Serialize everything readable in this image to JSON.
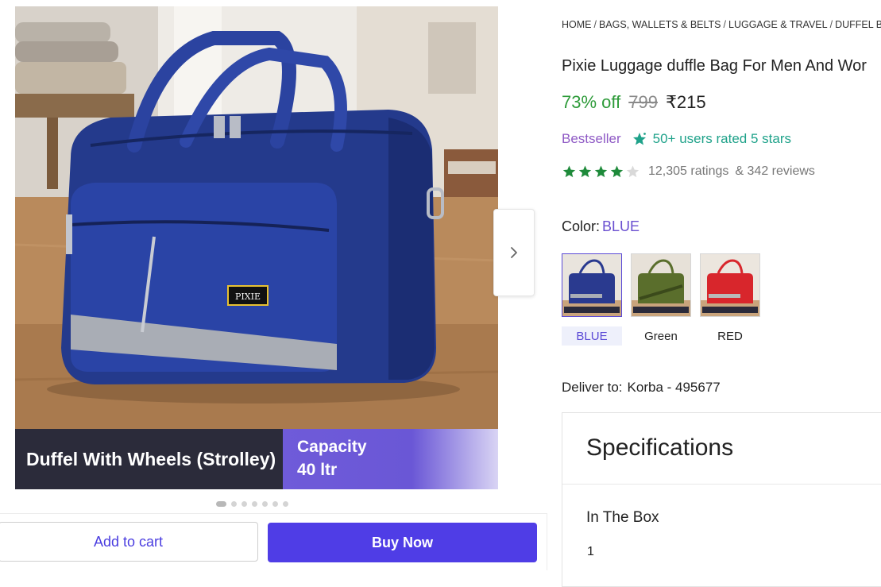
{
  "breadcrumb": [
    "HOME",
    "BAGS, WALLETS & BELTS",
    "LUGGAGE & TRAVEL",
    "DUFFEL B"
  ],
  "product": {
    "title": "Pixie Luggage duffle Bag For Men And Wor",
    "discount": "73% off",
    "mrp": "799",
    "price": "₹215",
    "badge": "Bestseller",
    "rated_text": "50+ users rated 5 stars",
    "rating_value": 4,
    "ratings_count": "12,305 ratings",
    "reviews_count": "& 342 reviews"
  },
  "gallery": {
    "brand_label": "PIXIE",
    "banner_left": "Duffel With Wheels (Strolley)",
    "banner_right_line1": "Capacity",
    "banner_right_line2": "40 ltr",
    "next_icon": "chevron-right-icon",
    "dots_count": 7,
    "active_dot": 0
  },
  "color": {
    "label": "Color:",
    "selected": "BLUE",
    "options": [
      {
        "name": "BLUE",
        "hex": "#2a3a8f"
      },
      {
        "name": "Green",
        "hex": "#5a6e2c"
      },
      {
        "name": "RED",
        "hex": "#d8262c"
      }
    ]
  },
  "delivery": {
    "label": "Deliver to:",
    "location": "Korba - 495677"
  },
  "specifications": {
    "title": "Specifications",
    "rows": [
      {
        "key": "In The Box",
        "value": "1"
      }
    ]
  },
  "actions": {
    "add_to_cart": "Add to cart",
    "buy_now": "Buy Now"
  },
  "colors": {
    "accent": "#4f3de6",
    "discount_green": "#2e9b3a",
    "bestseller_purple": "#8f5ac5",
    "rated_teal": "#1fa28a",
    "star_green": "#1e8a3a"
  }
}
